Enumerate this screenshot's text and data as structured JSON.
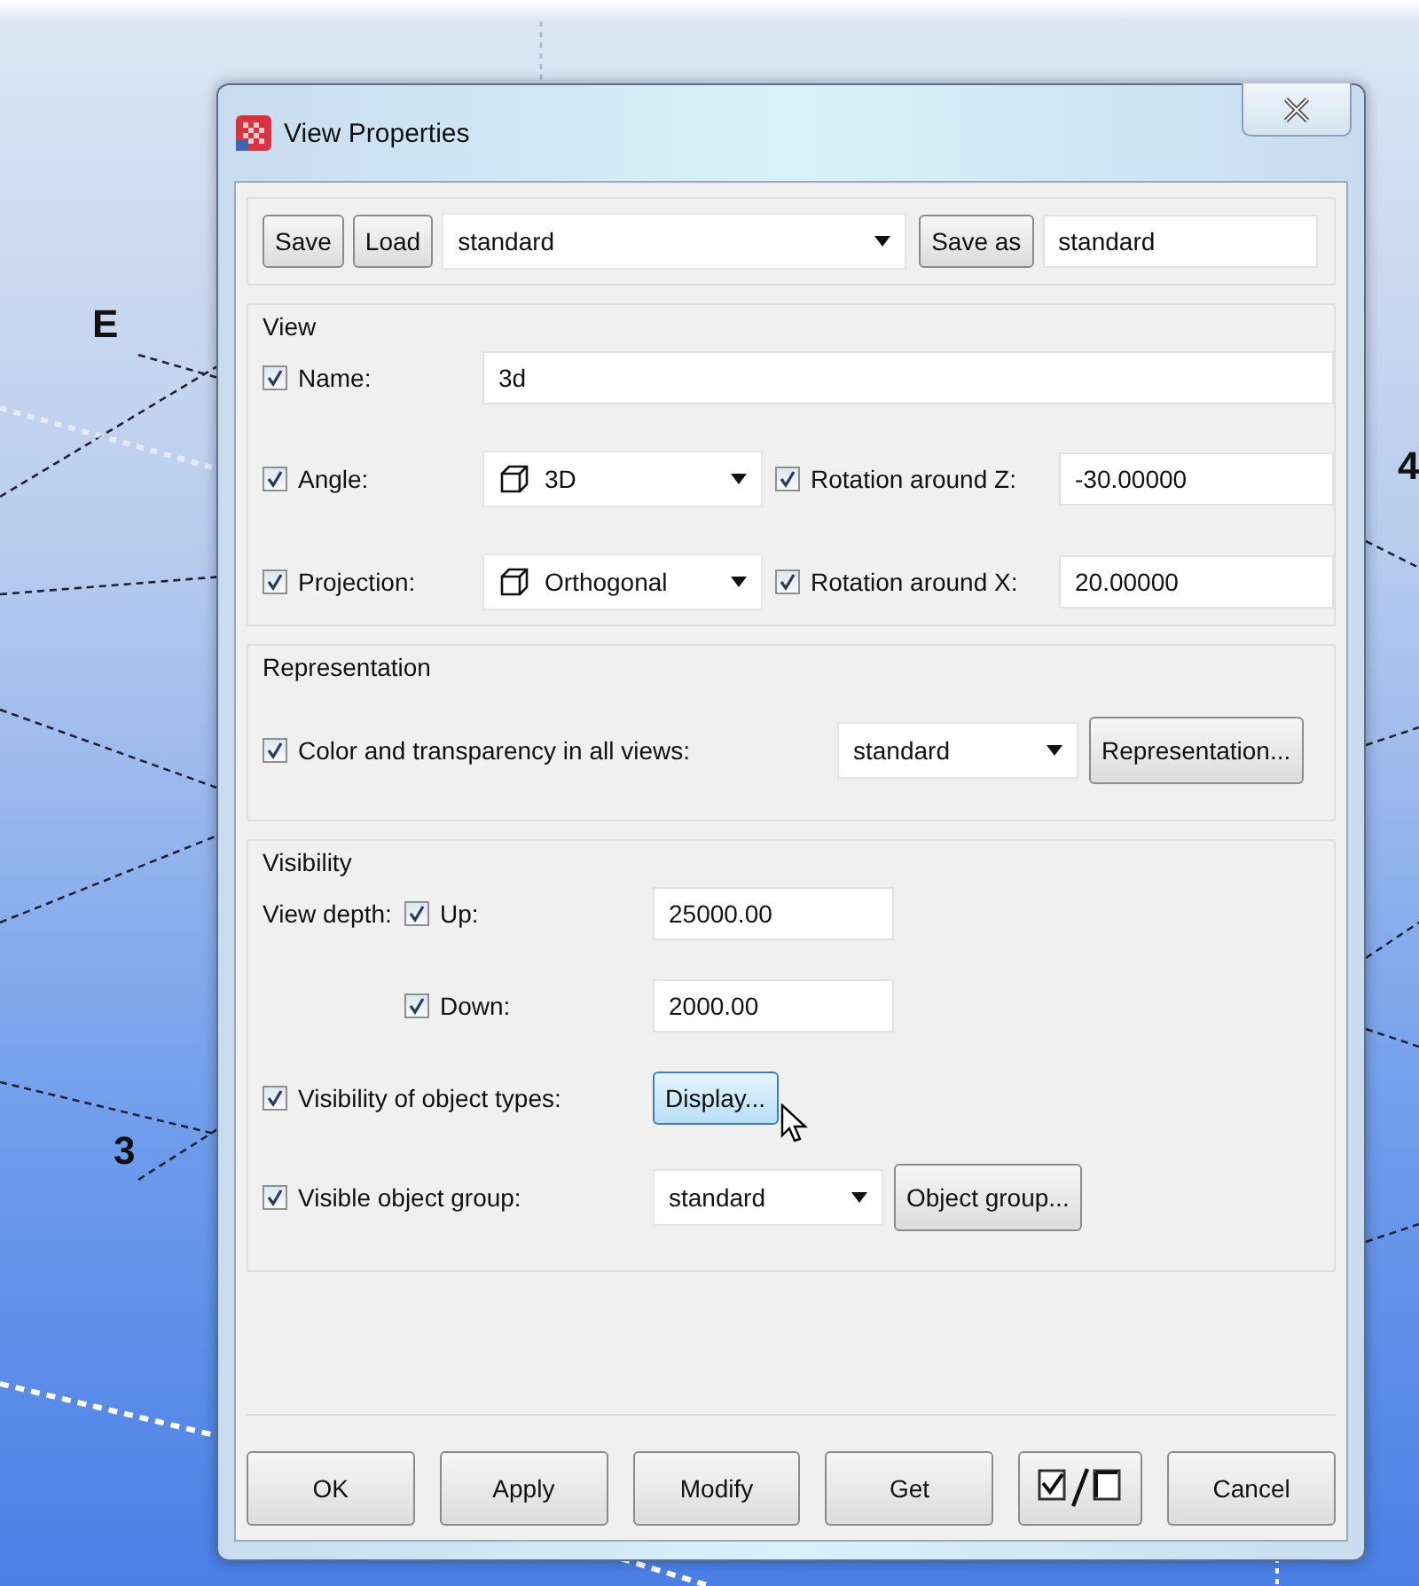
{
  "viewport": {
    "labels": [
      {
        "text": "E"
      },
      {
        "text": "3"
      },
      {
        "text": "4"
      }
    ]
  },
  "window": {
    "title": "View Properties"
  },
  "toolbar": {
    "save": "Save",
    "load": "Load",
    "settings": "standard",
    "save_as": "Save as",
    "save_as_name": "standard"
  },
  "view": {
    "title": "View",
    "name": {
      "label": "Name:",
      "checked": true,
      "value": "3d"
    },
    "angle": {
      "label": "Angle:",
      "checked": true,
      "value": "3D"
    },
    "rotation_z": {
      "label": "Rotation around Z:",
      "checked": true,
      "value": "-30.00000"
    },
    "projection": {
      "label": "Projection:",
      "checked": true,
      "value": "Orthogonal"
    },
    "rotation_x": {
      "label": "Rotation around X:",
      "checked": true,
      "value": "20.00000"
    }
  },
  "representation": {
    "title": "Representation",
    "color": {
      "label": "Color and transparency in all views:",
      "checked": true,
      "value": "standard"
    },
    "button": "Representation..."
  },
  "visibility": {
    "title": "Visibility",
    "depth_label": "View depth:",
    "up": {
      "label": "Up:",
      "checked": true,
      "value": "25000.00"
    },
    "down": {
      "label": "Down:",
      "checked": true,
      "value": "2000.00"
    },
    "object_types": {
      "label": "Visibility of object types:",
      "checked": true
    },
    "display_button": "Display...",
    "object_group": {
      "label": "Visible object group:",
      "checked": true,
      "value": "standard"
    },
    "object_group_button": "Object group..."
  },
  "buttons": [
    {
      "kind": "text",
      "label": "OK"
    },
    {
      "kind": "text",
      "label": "Apply"
    },
    {
      "kind": "text",
      "label": "Modify"
    },
    {
      "kind": "text",
      "label": "Get"
    },
    {
      "kind": "toggle-all"
    },
    {
      "kind": "text",
      "label": "Cancel"
    }
  ]
}
